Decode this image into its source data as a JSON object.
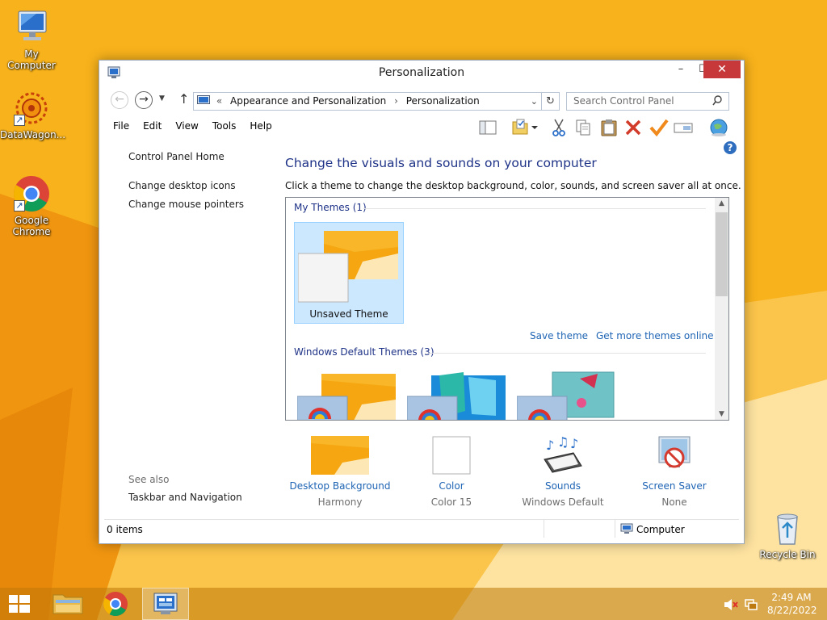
{
  "colors": {
    "wallpaper_base": "#f7a80e",
    "link_blue": "#1e64b4",
    "heading_blue": "#1e3287",
    "close_red": "#c7383b",
    "selection_blue": "#cce8ff"
  },
  "desktop": {
    "icons": [
      {
        "label": "My Computer",
        "icon": "computer-icon"
      },
      {
        "label": "DataWagon...",
        "icon": "datawagon-icon"
      },
      {
        "label": "Google Chrome",
        "icon": "chrome-icon"
      },
      {
        "label": "Recycle Bin",
        "icon": "recycle-bin-icon"
      }
    ]
  },
  "window": {
    "title": "Personalization",
    "buttons": {
      "minimize": "–",
      "maximize": "☐",
      "close": "✕"
    }
  },
  "address": {
    "prefix": "«",
    "crumbs": [
      "Appearance and Personalization",
      "Personalization"
    ],
    "search_placeholder": "Search Control Panel"
  },
  "menu": [
    "File",
    "Edit",
    "View",
    "Tools",
    "Help"
  ],
  "toolbar_icons": [
    "layout-icon",
    "properties-icon",
    "dropdown-icon",
    "cut-icon",
    "copy-icon",
    "paste-icon",
    "delete-icon",
    "checkmark-icon",
    "rename-icon",
    "globe-icon"
  ],
  "left_panel": {
    "home": "Control Panel Home",
    "links": [
      "Change desktop icons",
      "Change mouse pointers"
    ],
    "see_also": "See also",
    "see_also_links": [
      "Taskbar and Navigation"
    ]
  },
  "main": {
    "heading": "Change the visuals and sounds on your computer",
    "description": "Click a theme to change the desktop background, color, sounds, and screen saver all at once.",
    "my_themes_label": "My Themes (1)",
    "unsaved_theme": "Unsaved Theme",
    "save_theme": "Save theme",
    "get_more_themes": "Get more themes online",
    "default_themes_label": "Windows Default Themes (3)"
  },
  "settings": [
    {
      "label": "Desktop Background",
      "value": "Harmony",
      "icon": "desktop-background-icon"
    },
    {
      "label": "Color",
      "value": "Color 15",
      "icon": "color-icon"
    },
    {
      "label": "Sounds",
      "value": "Windows Default",
      "icon": "sounds-icon"
    },
    {
      "label": "Screen Saver",
      "value": "None",
      "icon": "screen-saver-icon"
    }
  ],
  "statusbar": {
    "items": "0 items",
    "location": "Computer"
  },
  "taskbar": {
    "time": "2:49 AM",
    "date": "8/22/2022"
  }
}
